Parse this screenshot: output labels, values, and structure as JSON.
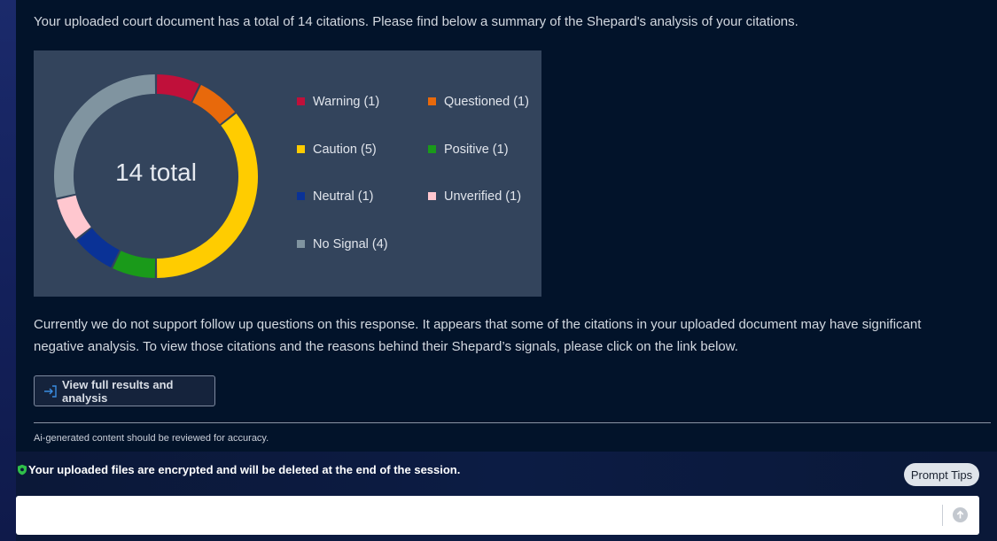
{
  "intro_text": "Your uploaded court document has a total of 14 citations. Please find below a summary of the Shepard's analysis of your citations.",
  "chart_data": {
    "type": "pie",
    "center_label": "14 total",
    "total": 14,
    "categories": [
      "Warning",
      "Questioned",
      "Caution",
      "Positive",
      "Neutral",
      "Unverified",
      "No Signal"
    ],
    "values": [
      1,
      1,
      5,
      1,
      1,
      1,
      4
    ],
    "colors": [
      "#c0103a",
      "#e8690b",
      "#ffcc00",
      "#1a9a1a",
      "#0a3296",
      "#ffc7cf",
      "#8094a0"
    ],
    "legend_labels": [
      "Warning (1)",
      "Questioned (1)",
      "Caution (5)",
      "Positive (1)",
      "Neutral (1)",
      "Unverified (1)",
      "No Signal (4)"
    ]
  },
  "followup_text": "Currently we do not support follow up questions on this response. It appears that some of the citations in your uploaded document may have significant negative analysis. To view those citations and the reasons behind their Shepard’s signals, please click on the link below.",
  "view_button_label": "View full results and analysis",
  "disclaimer": "Ai-generated content should be reviewed for accuracy.",
  "encryption_notice": "Your uploaded files are encrypted and will be deleted at the end of the session.",
  "prompt_tips_label": "Prompt Tips",
  "colors": {
    "panel_bg": "#02132a",
    "chart_bg": "#33445c",
    "shield_green": "#2fbf4a"
  },
  "icons": {
    "view": "enter-arrow-icon",
    "shield": "shield-icon",
    "send": "arrow-up-icon"
  }
}
